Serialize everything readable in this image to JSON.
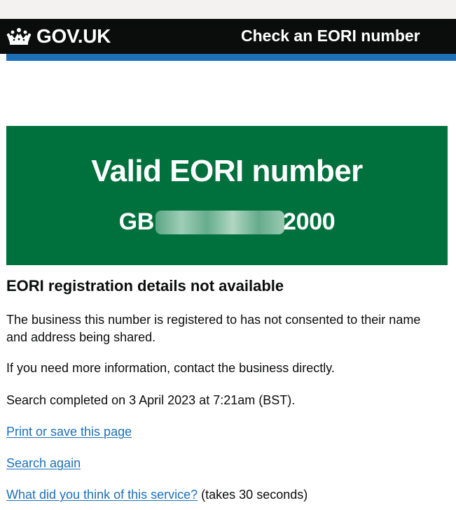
{
  "header": {
    "logo_text": "GOV.UK",
    "service_name": "Check an EORI number"
  },
  "colors": {
    "header_bg": "#0b0c0c",
    "brand_blue": "#1d70b8",
    "panel_green": "#00703c",
    "link": "#1d70b8",
    "text": "#0b0c0c"
  },
  "panel": {
    "title": "Valid EORI number",
    "eori_prefix": "GB",
    "eori_suffix": "2000"
  },
  "main": {
    "heading": "EORI registration details not available",
    "paragraph_consent": "The business this number is registered to has not consented to their name and address being shared.",
    "paragraph_contact": "If you need more information, contact the business directly.",
    "paragraph_search_completed": "Search completed on 3 April 2023 at 7:21am (BST).",
    "print_link": "Print or save this page",
    "search_again_link": "Search again",
    "feedback_link": "What did you think of this service?",
    "feedback_suffix": "(takes 30 seconds)"
  }
}
